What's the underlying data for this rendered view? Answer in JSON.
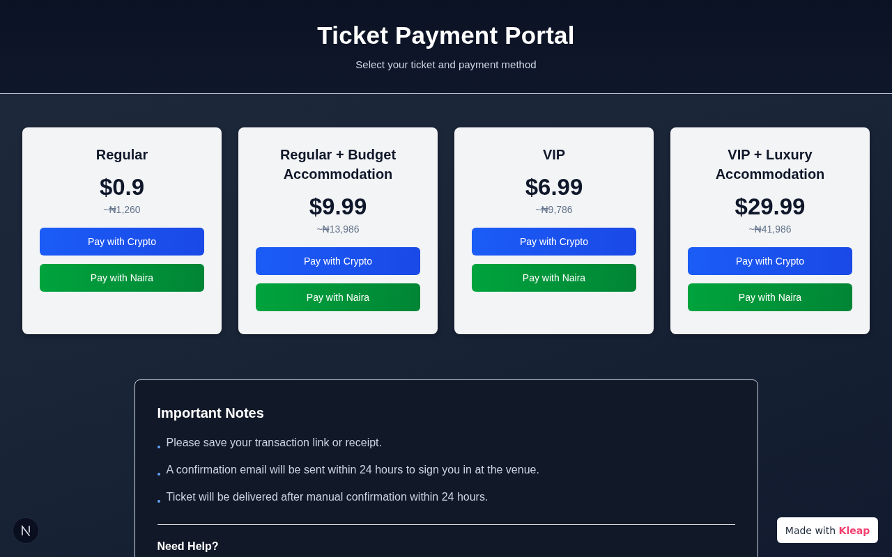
{
  "header": {
    "title": "Ticket Payment Portal",
    "subtitle": "Select your ticket and payment method"
  },
  "tickets": [
    {
      "name": "Regular",
      "price": "$0.9",
      "local_price": "~₦1,260",
      "buttons": [
        {
          "kind": "crypto",
          "label": "Pay with Crypto"
        },
        {
          "kind": "naira",
          "label": "Pay with Naira"
        }
      ]
    },
    {
      "name": "Regular + Budget Accommodation",
      "price": "$9.99",
      "local_price": "~₦13,986",
      "buttons": [
        {
          "kind": "crypto",
          "label": "Pay with Crypto"
        },
        {
          "kind": "naira",
          "label": "Pay with Naira"
        }
      ]
    },
    {
      "name": "VIP",
      "price": "$6.99",
      "local_price": "~₦9,786",
      "buttons": [
        {
          "kind": "crypto",
          "label": "Pay with Crypto"
        },
        {
          "kind": "naira",
          "label": "Pay with Naira"
        }
      ]
    },
    {
      "name": "VIP + Luxury Accommodation",
      "price": "$29.99",
      "local_price": "~₦41,986",
      "buttons": [
        {
          "kind": "crypto",
          "label": "Pay with Crypto"
        },
        {
          "kind": "naira",
          "label": "Pay with Naira"
        }
      ]
    }
  ],
  "notes": {
    "title": "Important Notes",
    "items": [
      "Please save your transaction link or receipt.",
      "A confirmation email will be sent within 24 hours to sign you in at the venue.",
      "Ticket will be delivered after manual confirmation within 24 hours."
    ],
    "help_title": "Need Help?"
  },
  "badge": {
    "text": "Made with **Kleap**"
  }
}
